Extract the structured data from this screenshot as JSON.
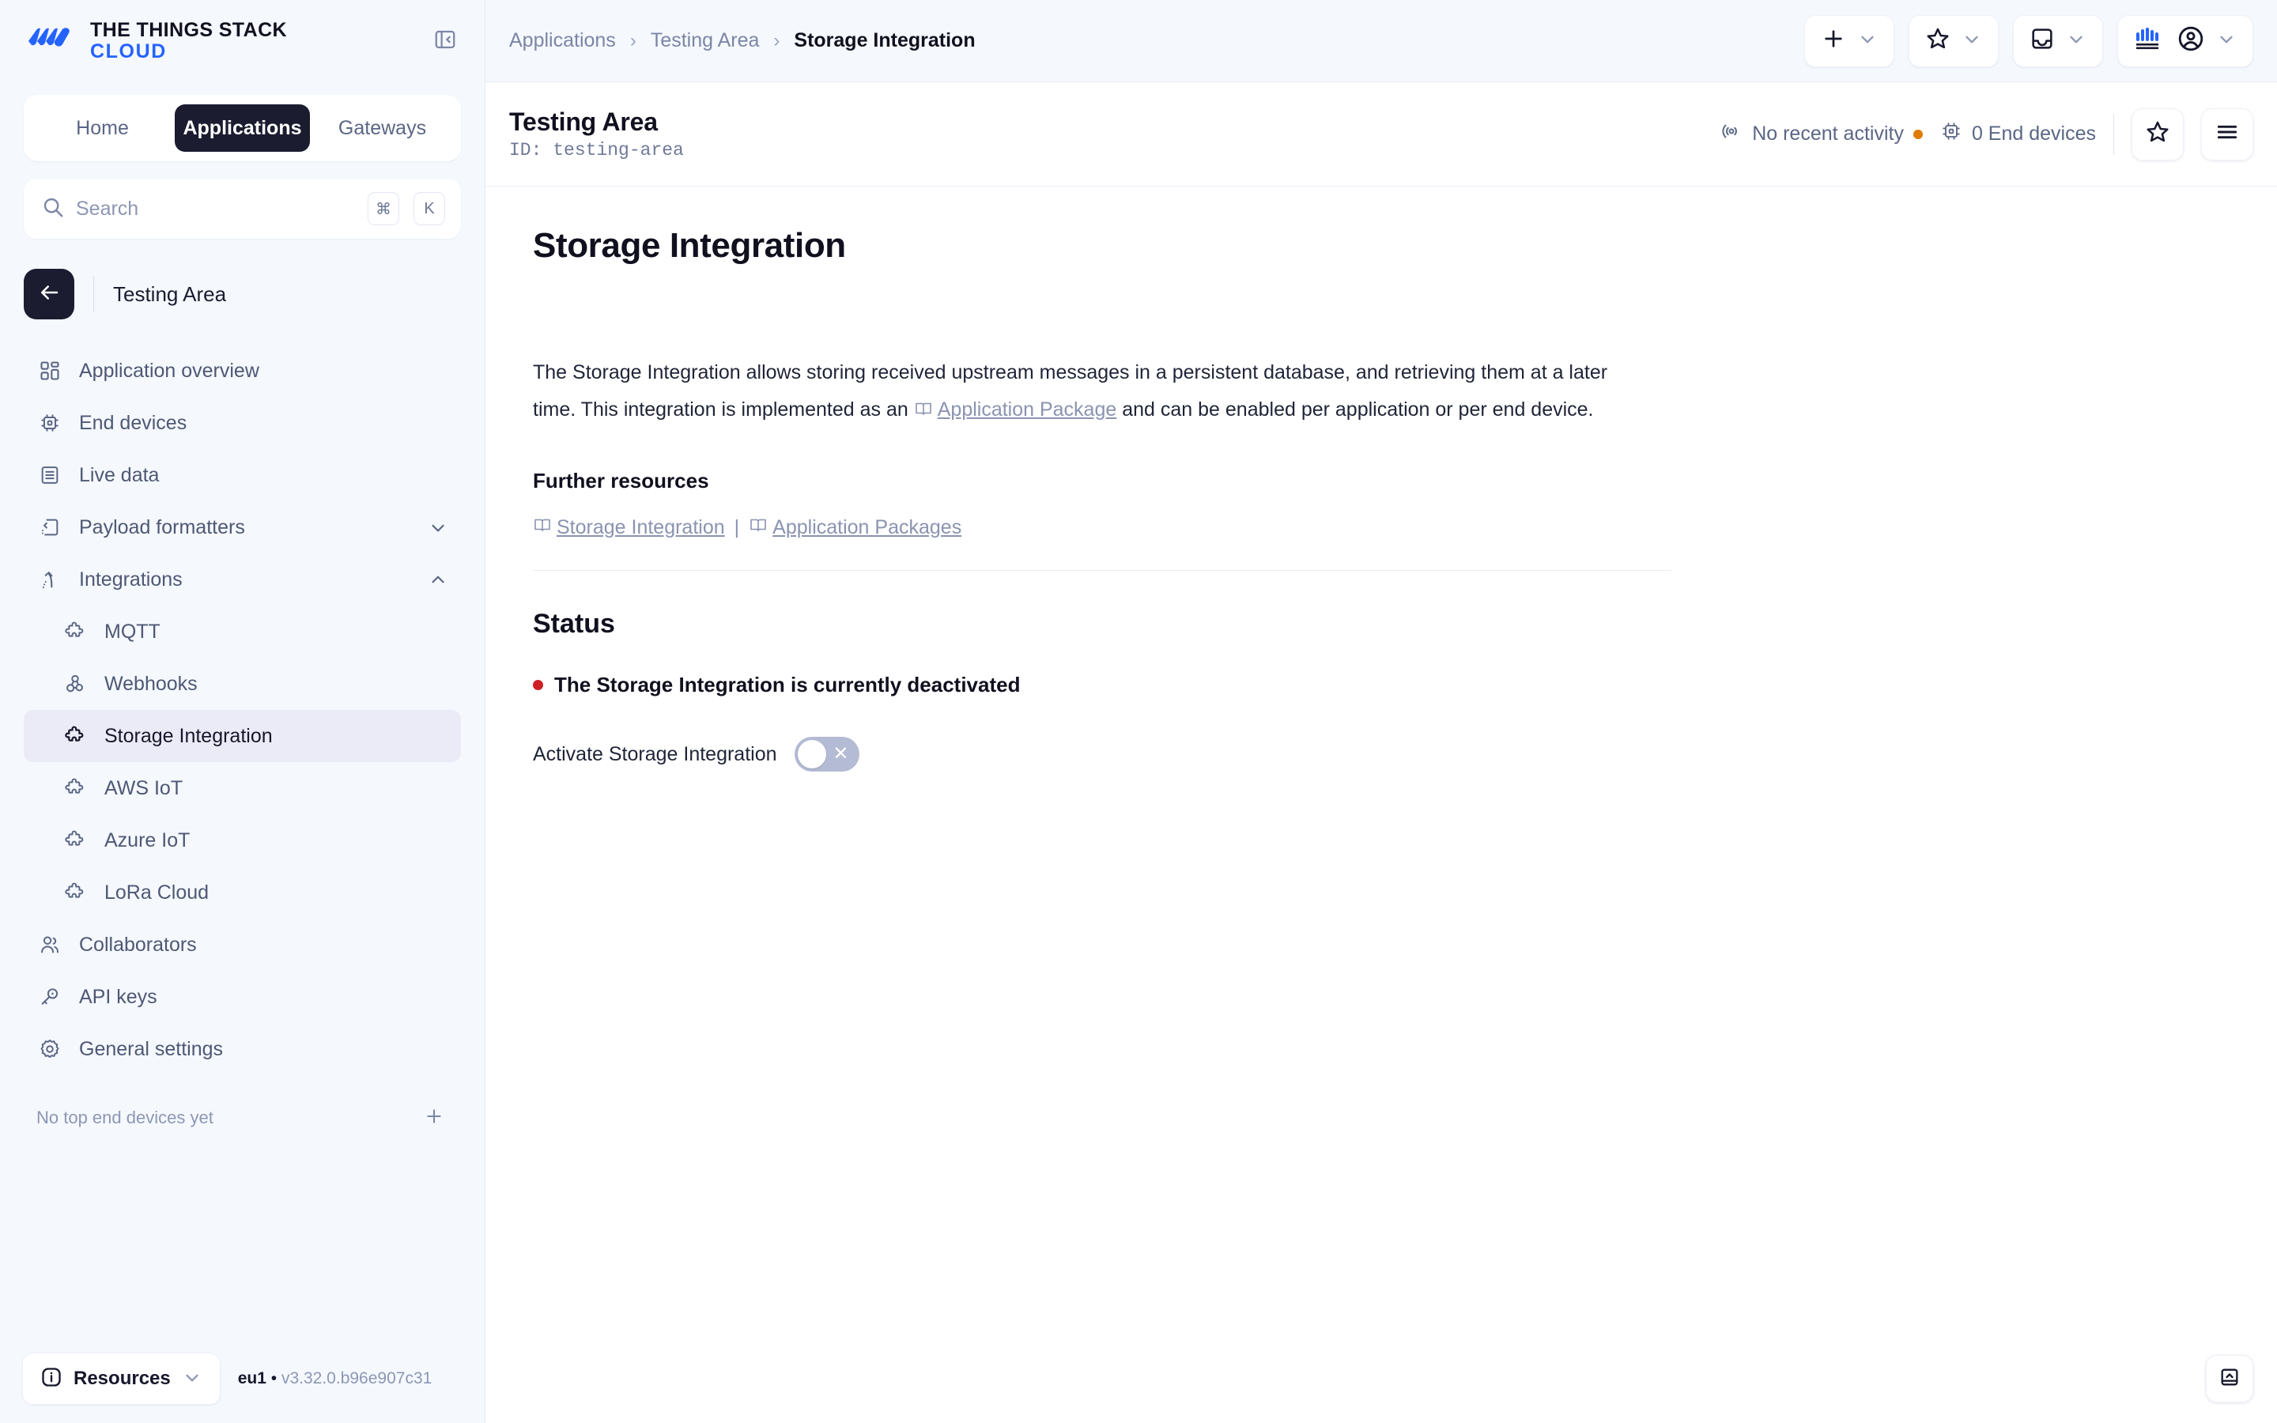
{
  "brand": {
    "line1": "THE THINGS STACK",
    "line2": "CLOUD",
    "logo_color": "#2563ff"
  },
  "sidebar": {
    "tabs": [
      {
        "label": "Home",
        "active": false
      },
      {
        "label": "Applications",
        "active": true
      },
      {
        "label": "Gateways",
        "active": false
      }
    ],
    "search": {
      "placeholder": "Search",
      "value": "",
      "kbd1": "⌘",
      "kbd2": "K"
    },
    "context": {
      "name": "Testing Area"
    },
    "nav": [
      {
        "label": "Application overview",
        "icon": "grid-icon",
        "level": 0,
        "active": false
      },
      {
        "label": "End devices",
        "icon": "chip-icon",
        "level": 0,
        "active": false
      },
      {
        "label": "Live data",
        "icon": "list-icon",
        "level": 0,
        "active": false
      },
      {
        "label": "Payload formatters",
        "icon": "code-icon",
        "level": 0,
        "active": false,
        "chevron": "chevron-down-icon"
      },
      {
        "label": "Integrations",
        "icon": "integrations-icon",
        "level": 0,
        "active": false,
        "chevron": "chevron-up-icon"
      },
      {
        "label": "MQTT",
        "icon": "puzzle-icon",
        "level": 1,
        "active": false
      },
      {
        "label": "Webhooks",
        "icon": "webhook-icon",
        "level": 1,
        "active": false
      },
      {
        "label": "Storage Integration",
        "icon": "puzzle-icon",
        "level": 1,
        "active": true
      },
      {
        "label": "AWS IoT",
        "icon": "puzzle-icon",
        "level": 1,
        "active": false
      },
      {
        "label": "Azure IoT",
        "icon": "puzzle-icon",
        "level": 1,
        "active": false
      },
      {
        "label": "LoRa Cloud",
        "icon": "puzzle-icon",
        "level": 1,
        "active": false
      },
      {
        "label": "Collaborators",
        "icon": "users-icon",
        "level": 0,
        "active": false
      },
      {
        "label": "API keys",
        "icon": "key-icon",
        "level": 0,
        "active": false
      },
      {
        "label": "General settings",
        "icon": "gear-icon",
        "level": 0,
        "active": false
      }
    ],
    "empty_devices": {
      "text": "No top end devices yet",
      "add_icon": "plus-icon"
    },
    "footer": {
      "resources_label": "Resources",
      "cluster": "eu1",
      "separator": "•",
      "version": "v3.32.0.b96e907c31"
    }
  },
  "topbar": {
    "breadcrumbs": [
      {
        "label": "Applications",
        "current": false
      },
      {
        "label": "Testing Area",
        "current": false
      },
      {
        "label": "Storage Integration",
        "current": true
      }
    ],
    "separator": "›",
    "actions": [
      {
        "name": "add-button",
        "icon": "plus-icon"
      },
      {
        "name": "bookmarks-button",
        "icon": "star-icon"
      },
      {
        "name": "notifications-button",
        "icon": "inbox-icon"
      },
      {
        "name": "account-button",
        "icon": "account-icon"
      }
    ]
  },
  "pagehead": {
    "title": "Testing Area",
    "id_prefix": "ID:",
    "id_value": "testing-area",
    "activity": "No recent activity",
    "activity_dot_color": "#e07b00",
    "devices": "0 End devices",
    "star_icon": "star-icon",
    "menu_icon": "hamburger-icon"
  },
  "main": {
    "heading": "Storage Integration",
    "paragraph": {
      "part1": "The Storage Integration allows storing received upstream messages in a persistent database, and retrieving them at a later time. This integration is implemented as an",
      "link": "Application Package",
      "part2": "and can be enabled per application or per end device."
    },
    "further_resources": {
      "heading": "Further resources",
      "links": [
        {
          "label": "Storage Integration"
        },
        {
          "label": "Application Packages"
        }
      ],
      "separator": "|"
    },
    "status": {
      "heading": "Status",
      "dot_color": "#cf2027",
      "message": "The Storage Integration is currently deactivated",
      "toggle_label": "Activate Storage Integration",
      "toggle_on": false,
      "toggle_off_glyph": "✕"
    },
    "corner_button_icon": "panel-expand-icon"
  }
}
